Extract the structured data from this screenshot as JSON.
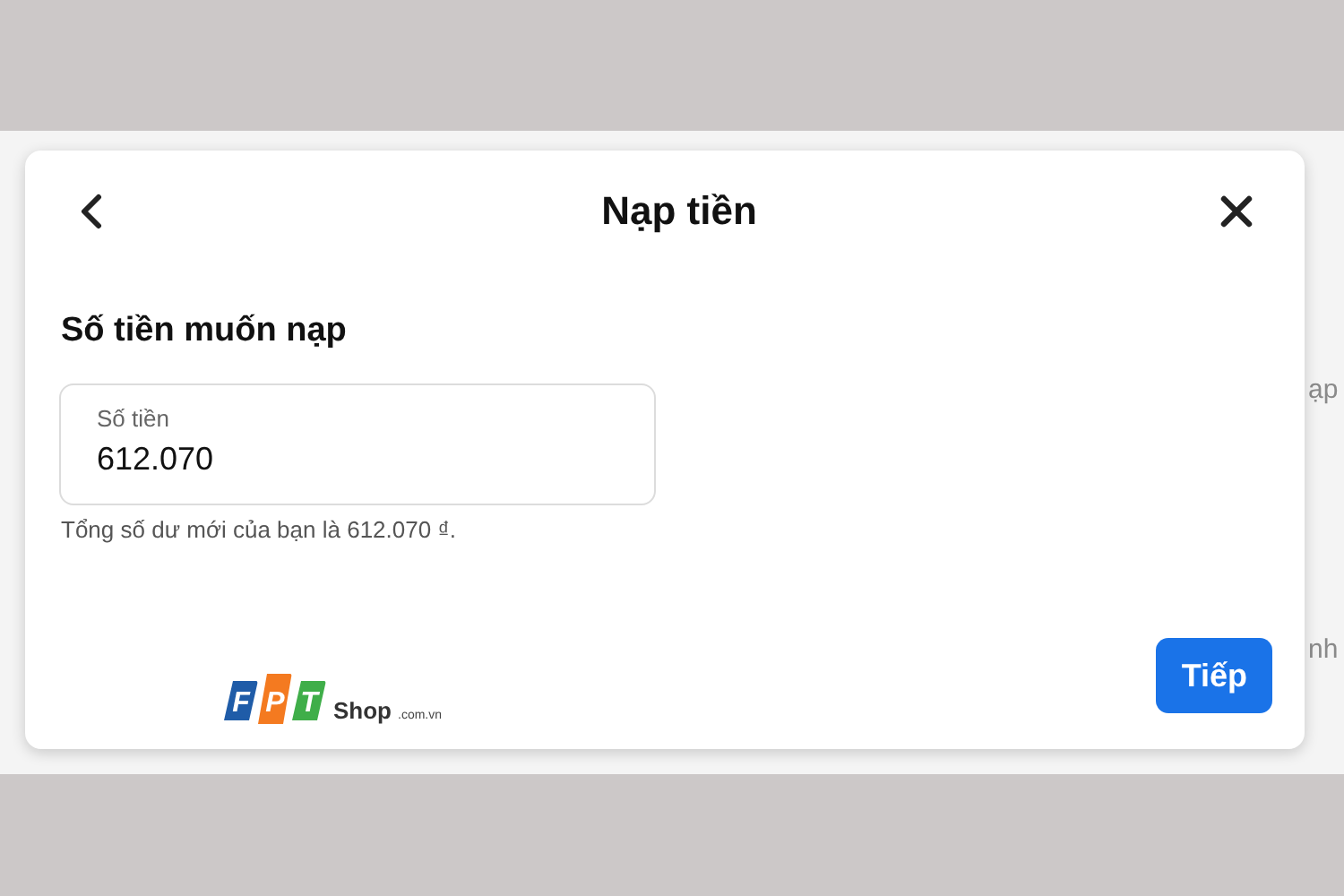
{
  "background": {
    "fragments": [
      "ạp",
      "nh"
    ]
  },
  "dialog": {
    "title": "Nạp tiền",
    "section_title": "Số tiền muốn nạp",
    "amount_field": {
      "label": "Số tiền",
      "value": "612.070"
    },
    "helper_text": "Tổng số dư mới của bạn là 612.070 ₫.",
    "logo": {
      "letters": [
        "F",
        "P",
        "T"
      ],
      "name": "Shop",
      "domain": ".com.vn"
    },
    "buttons": [
      {
        "kind": "primary",
        "label": "Tiếp"
      }
    ]
  }
}
